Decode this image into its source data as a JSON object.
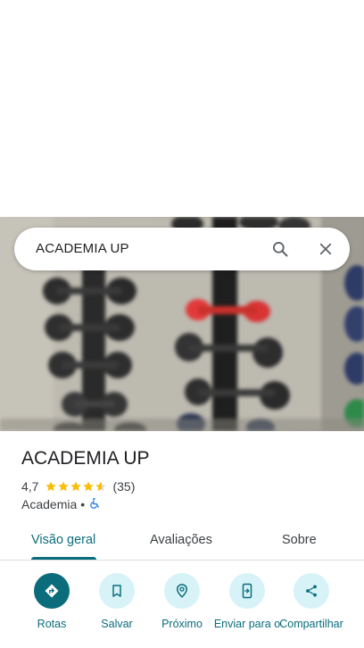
{
  "search": {
    "query": "ACADEMIA UP",
    "search_icon": "search-icon",
    "close_icon": "close-icon"
  },
  "photo": {
    "subject": "dumbbell rack"
  },
  "place": {
    "name": "ACADEMIA UP",
    "rating": "4,7",
    "rating_value": 4.7,
    "reviews_count": "(35)",
    "category": "Academia",
    "separator": "•",
    "accessibility_icon": "wheelchair-icon"
  },
  "tabs": [
    {
      "label": "Visão geral",
      "active": true
    },
    {
      "label": "Avaliações",
      "active": false
    },
    {
      "label": "Sobre",
      "active": false
    }
  ],
  "actions": [
    {
      "label": "Rotas",
      "icon": "directions-icon"
    },
    {
      "label": "Salvar",
      "icon": "bookmark-icon"
    },
    {
      "label": "Próximo",
      "icon": "nearby-icon"
    },
    {
      "label": "Enviar para o",
      "icon": "send-to-phone-icon"
    },
    {
      "label": "Compartilhar",
      "icon": "share-icon"
    }
  ],
  "colors": {
    "accent": "#0b6c7c",
    "chip_bg": "#d7f3f7",
    "star": "#fbbc04",
    "accessibility": "#1a73e8"
  }
}
